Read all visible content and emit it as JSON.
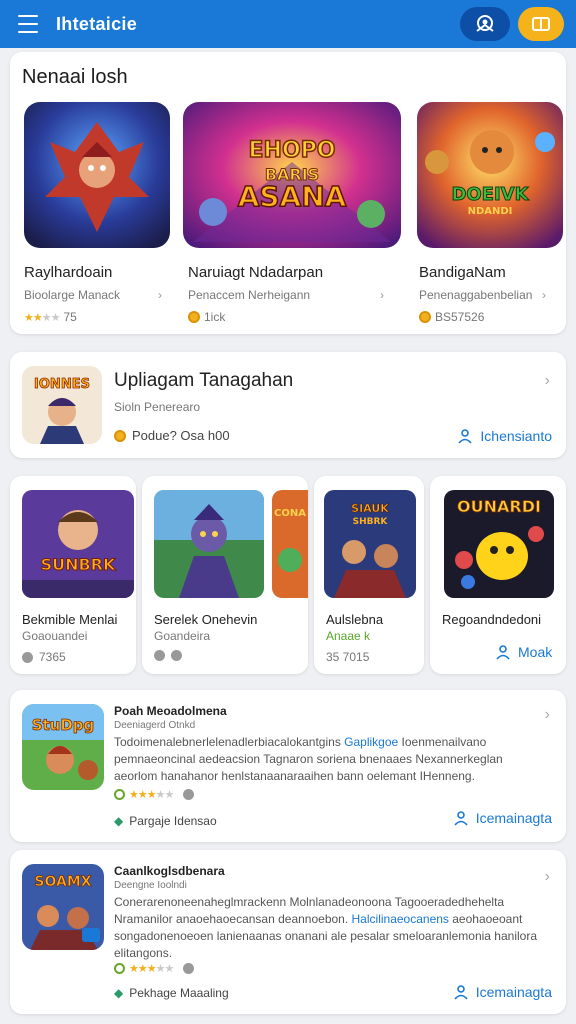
{
  "header": {
    "title": "Ihtetaicie",
    "menu_icon": "menu-icon",
    "account_icon": "account-icon",
    "library_icon": "library-icon",
    "accent": "#1a78d6",
    "gold": "#f5b21b"
  },
  "featured": {
    "heading": "Nenaai losh",
    "items": [
      {
        "name": "Raylhardoain",
        "sub": "Bioolarge Manack",
        "rating_text": "75",
        "stars": 2.5
      },
      {
        "name": "Naruiagt Ndadarpan",
        "sub": "Penaccem Nerheigann",
        "rating_text": "1ick"
      },
      {
        "name": "BandigaNam",
        "sub": "Penenaggabenbelian",
        "rating_text": "BS57526"
      }
    ]
  },
  "promo": {
    "title": "Upliagam Tanagahan",
    "subtitle": "Sioln Penerearo",
    "price": "Podue? Osa h00",
    "action": "Ichensianto"
  },
  "tiles": [
    {
      "name": "Bekmible Menlai",
      "sub": "Goaouandei",
      "meta": "7365"
    },
    {
      "name": "Serelek Onehevin",
      "sub": "Goandeira",
      "meta": ""
    },
    {
      "name": "Aulslebna",
      "sub": "Anaae k",
      "meta": "35 7015"
    },
    {
      "name": "Regoandndedoni",
      "action": "Moak"
    }
  ],
  "list": [
    {
      "title": "Poah Meoadolmena",
      "subtitle": "Deeniagerd Otnkd",
      "desc_a": "Todoimenalebnerlelenadlerbiacalokantgins ",
      "desc_link": "Gaplikgoe",
      "desc_b": " Ioenmenailvano pemnaeoncinal aedeacsion Tagnaron soriena bnenaaes Nexannerkeglan aeorlom hanahanor henlstanaanaraaihen bann oelemant IHenneng.",
      "publisher": "Pargaje Idensao",
      "action": "Icemainagta",
      "stars": 3
    },
    {
      "title": "Caanlkoglsdbenara",
      "subtitle": "Deengne Ioolndi",
      "desc_a": "Conerarenoneenaheglmrackenn Molnlanadeonoona Tagooeradedhehelta Nramanilor anaoehaoecansan deannoebon. ",
      "desc_link": "Halcilinaeocanens",
      "desc_b": " aeohaoeoant songadonenoeoen lanienaanas onanani ale pesalar smeloaranlemonia hanilora elitangons.",
      "publisher": "Pekhage Maaaling",
      "action": "Icemainagta",
      "stars": 3
    }
  ]
}
